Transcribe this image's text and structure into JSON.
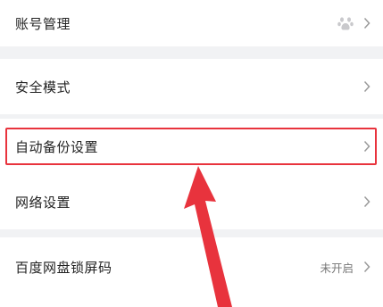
{
  "settings": {
    "items": [
      {
        "label": "账号管理",
        "value": "",
        "icon": "paw-icon"
      },
      {
        "label": "安全模式",
        "value": ""
      },
      {
        "label": "自动备份设置",
        "value": ""
      },
      {
        "label": "网络设置",
        "value": ""
      },
      {
        "label": "百度网盘锁屏码",
        "value": "未开启"
      }
    ]
  },
  "colors": {
    "background": "#f1f2f4",
    "row": "#ffffff",
    "highlight": "#e8333d",
    "arrow": "#e8333d"
  }
}
